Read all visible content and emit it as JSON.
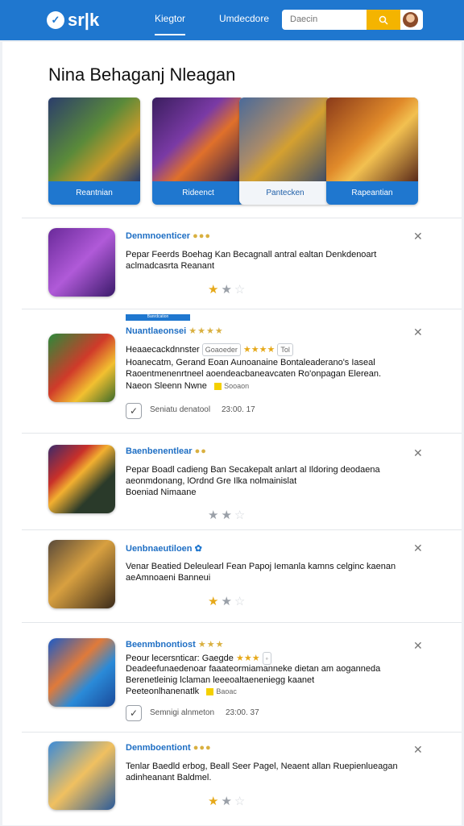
{
  "header": {
    "logo": "sr|k",
    "nav": [
      "Kiegtor",
      "Umdecdore"
    ],
    "search_placeholder": "Daecin"
  },
  "featured": {
    "title": "Nina Behaganj Nleagan",
    "cards": [
      {
        "label": "Reantnian"
      },
      {
        "label": "Rideenct"
      },
      {
        "label": "Pantecken"
      },
      {
        "label": "Rapeantian"
      }
    ]
  },
  "rows": [
    {
      "title": "Denmnoenticer",
      "lines": [
        "Pepar Feerds Boehag Kan Becagnall antral ealtan Denkdenoart",
        "aclmadcasrta Reanant"
      ]
    },
    {
      "tag": "Banrdcation",
      "title": "Nuantlaeonsei",
      "lines": [
        "Heaaecackdnnster",
        "Hoanecatm, Gerand Eoan Aunoanaine Bontaleaderano's Iaseal",
        "Raoentmenenrtneel aoendeacbaneavcaten Ro'onpagan Elerean.",
        "Naeon Sleenn Nwne"
      ],
      "pill1": "Goaoeder",
      "pill2": "Tol",
      "badge": "Sooaon",
      "meta": [
        "Seniatu denatool",
        "23:00. 17"
      ]
    },
    {
      "title": "Baenbenentlear",
      "lines": [
        "Pepar Boadl cadieng Ban Secakepalt anlart al Ildoring deodaena",
        "aeonmdonang, lOrdnd Gre Ilka nolmainislat",
        "Boeniad Nimaane"
      ]
    },
    {
      "title": "Uenbnaeutiloen",
      "lines": [
        "Venar Beatied Deleulearl Fean Papoj Iemanla kamns celginc kaenan",
        "aeAmnoaeni Banneui"
      ]
    },
    {
      "title": "Beenmbnontiost",
      "lines": [
        "Peour lecersnticar: Gaegde",
        "Deadeefunaedenoar faaateormiamanneke dietan am aoganneda",
        "Berenetleinig lclaman leeeoaltaeneniegg kaanet",
        "Peeteonlhanenatlk"
      ],
      "badge": "Baoac",
      "meta": [
        "Semnigi alnmeton",
        "23:00. 37"
      ]
    },
    {
      "title": "Denmboentiont",
      "lines": [
        "Tenlar Baedld erbog, Beall Seer Pagel, Neaent allan Ruepienlueagan",
        "adinheanant Baldmel."
      ]
    }
  ]
}
